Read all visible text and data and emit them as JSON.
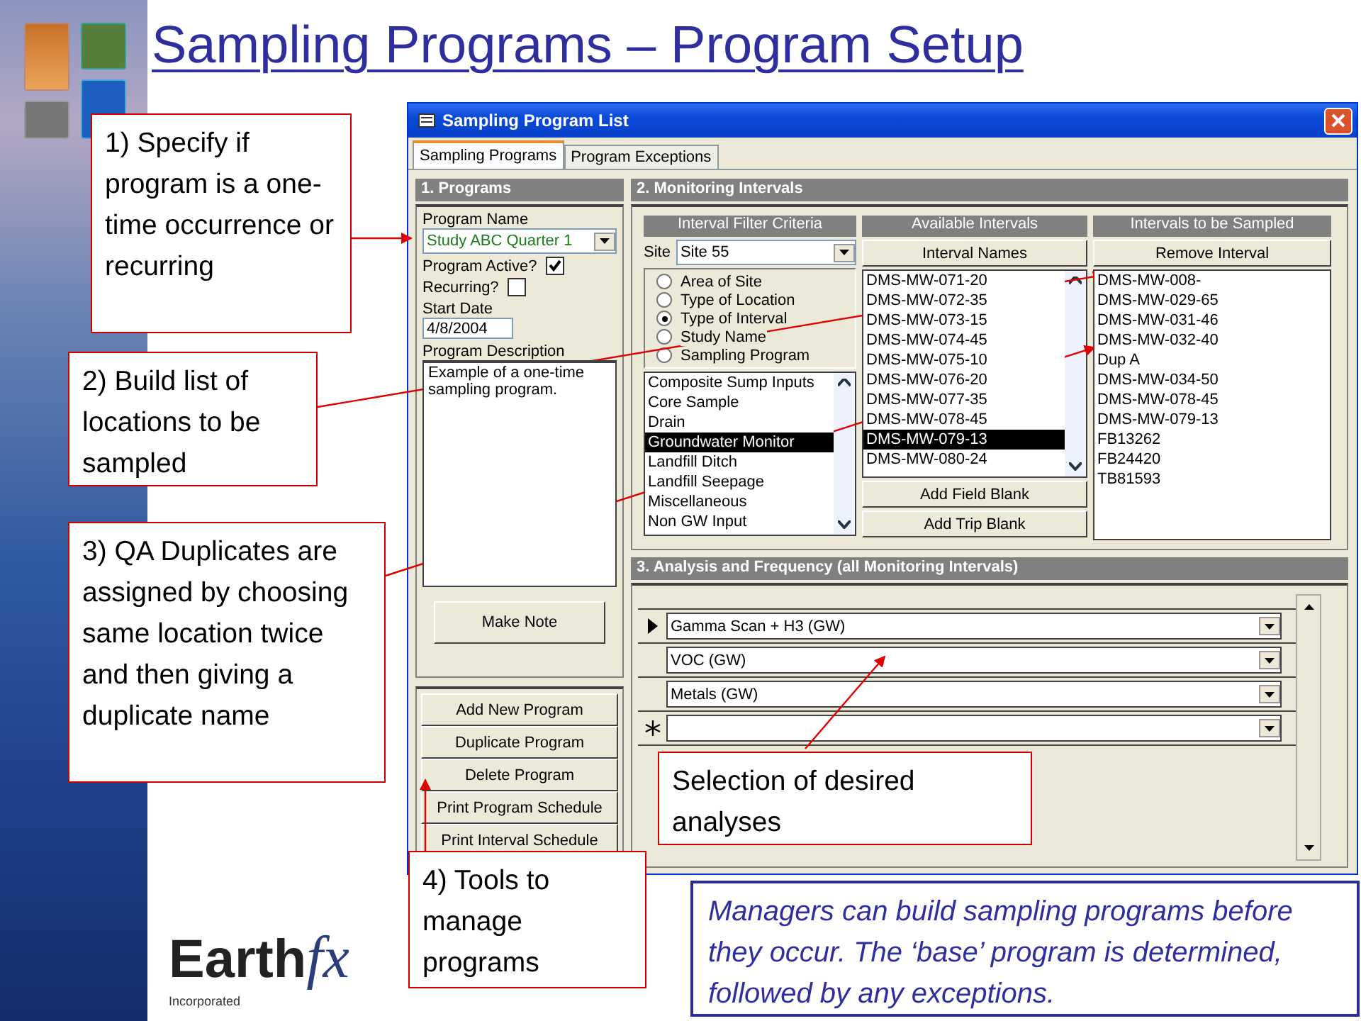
{
  "slide_title": "Sampling Programs – Program Setup",
  "window": {
    "title": "Sampling Program List"
  },
  "tabs": [
    {
      "label": "Sampling Programs",
      "selected": true
    },
    {
      "label": "Program Exceptions",
      "selected": false
    }
  ],
  "programs": {
    "header": "1. Programs",
    "program_name_label": "Program Name",
    "program_name": "Study ABC Quarter 1",
    "checkboxes": [
      {
        "label": "Program Active?",
        "checked": true
      },
      {
        "label": "Recurring?",
        "checked": false
      }
    ],
    "start_date_label": "Start Date",
    "start_date": "4/8/2004",
    "description_label": "Program Description",
    "description": "Example of a one-time sampling program.",
    "make_note": "Make Note",
    "buttons": [
      "Add New Program",
      "Duplicate Program",
      "Delete Program",
      "Print Program Schedule",
      "Print Interval Schedule"
    ]
  },
  "monitoring": {
    "header": "2. Monitoring Intervals",
    "filter_header": "Interval Filter Criteria",
    "site_label": "Site",
    "site": "Site 55",
    "radios": [
      {
        "label": "Area of Site",
        "selected": false
      },
      {
        "label": "Type of Location",
        "selected": false
      },
      {
        "label": "Type of Interval",
        "selected": true
      },
      {
        "label": "Study Name",
        "selected": false
      },
      {
        "label": "Sampling Program",
        "selected": false
      }
    ],
    "types": [
      {
        "label": "Composite Sump Inputs",
        "selected": false
      },
      {
        "label": "Core Sample",
        "selected": false
      },
      {
        "label": "Drain",
        "selected": false
      },
      {
        "label": "Groundwater Monitor",
        "selected": true
      },
      {
        "label": "Landfill Ditch",
        "selected": false
      },
      {
        "label": "Landfill Seepage",
        "selected": false
      },
      {
        "label": "Miscellaneous",
        "selected": false
      },
      {
        "label": "Non GW Input",
        "selected": false
      }
    ],
    "available_header": "Available Intervals",
    "interval_names_button": "Interval Names",
    "available": [
      {
        "label": "DMS-MW-071-20",
        "selected": false
      },
      {
        "label": "DMS-MW-072-35",
        "selected": false
      },
      {
        "label": "DMS-MW-073-15",
        "selected": false
      },
      {
        "label": "DMS-MW-074-45",
        "selected": false
      },
      {
        "label": "DMS-MW-075-10",
        "selected": false
      },
      {
        "label": "DMS-MW-076-20",
        "selected": false
      },
      {
        "label": "DMS-MW-077-35",
        "selected": false
      },
      {
        "label": "DMS-MW-078-45",
        "selected": false
      },
      {
        "label": "DMS-MW-079-13",
        "selected": true
      },
      {
        "label": "DMS-MW-080-24",
        "selected": false
      }
    ],
    "add_field_blank": "Add Field Blank",
    "add_trip_blank": "Add Trip Blank",
    "sampled_header": "Intervals to be Sampled",
    "remove_button": "Remove Interval",
    "sampled": [
      "DMS-MW-008-",
      "DMS-MW-029-65",
      "DMS-MW-031-46",
      "DMS-MW-032-40",
      "Dup A",
      "DMS-MW-034-50",
      "DMS-MW-078-45",
      "DMS-MW-079-13",
      "FB13262",
      "FB24420",
      "TB81593"
    ]
  },
  "analysis": {
    "header": "3. Analysis and Frequency (all Monitoring Intervals)",
    "rows": [
      {
        "kind": "current",
        "value": "Gamma Scan + H3 (GW)"
      },
      {
        "kind": "normal",
        "value": "VOC (GW)"
      },
      {
        "kind": "normal",
        "value": "Metals (GW)"
      },
      {
        "kind": "new"
      }
    ]
  },
  "callouts": [
    {
      "text": "1) Specify if program is a one-time occurrence or recurring"
    },
    {
      "text": "2) Build list of locations to be sampled"
    },
    {
      "text": "3) QA Duplicates are assigned by choosing same location twice and then giving a duplicate name"
    },
    {
      "text": "4) Tools to manage programs"
    },
    {
      "text": "Selection of desired analyses"
    }
  ],
  "note": "Managers can build sampling programs before they occur. The ‘base’ program is determined, followed by any exceptions.",
  "logo": {
    "name": "Earth",
    "suffix": "fx",
    "tagline": "Incorporated"
  }
}
